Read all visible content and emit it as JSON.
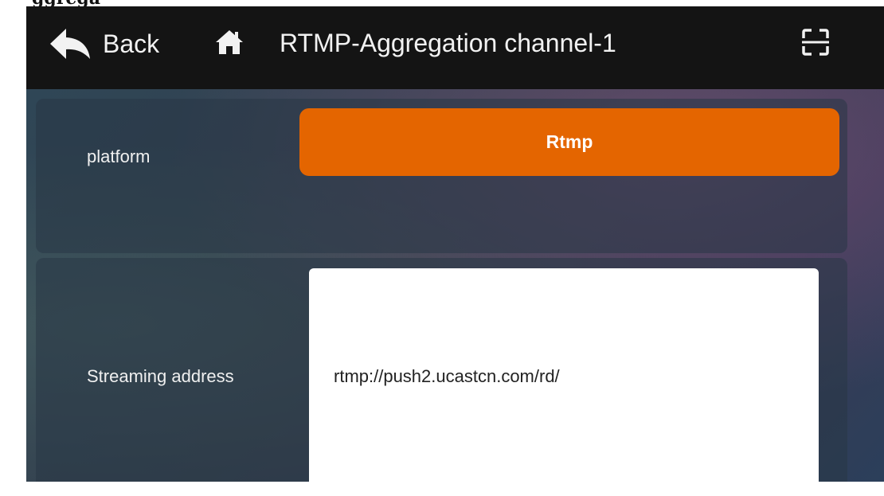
{
  "header": {
    "back_label": "Back",
    "title": "RTMP-Aggregation channel-1"
  },
  "platform": {
    "label": "platform",
    "value": "Rtmp"
  },
  "streaming": {
    "label": "Streaming address",
    "value": "rtmp://push2.ucastcn.com/rd/"
  },
  "colors": {
    "accent": "#e46500",
    "header_bg": "#141414"
  },
  "icons": {
    "back": "back-arrow-icon",
    "home": "home-icon",
    "scan": "scan-icon"
  }
}
